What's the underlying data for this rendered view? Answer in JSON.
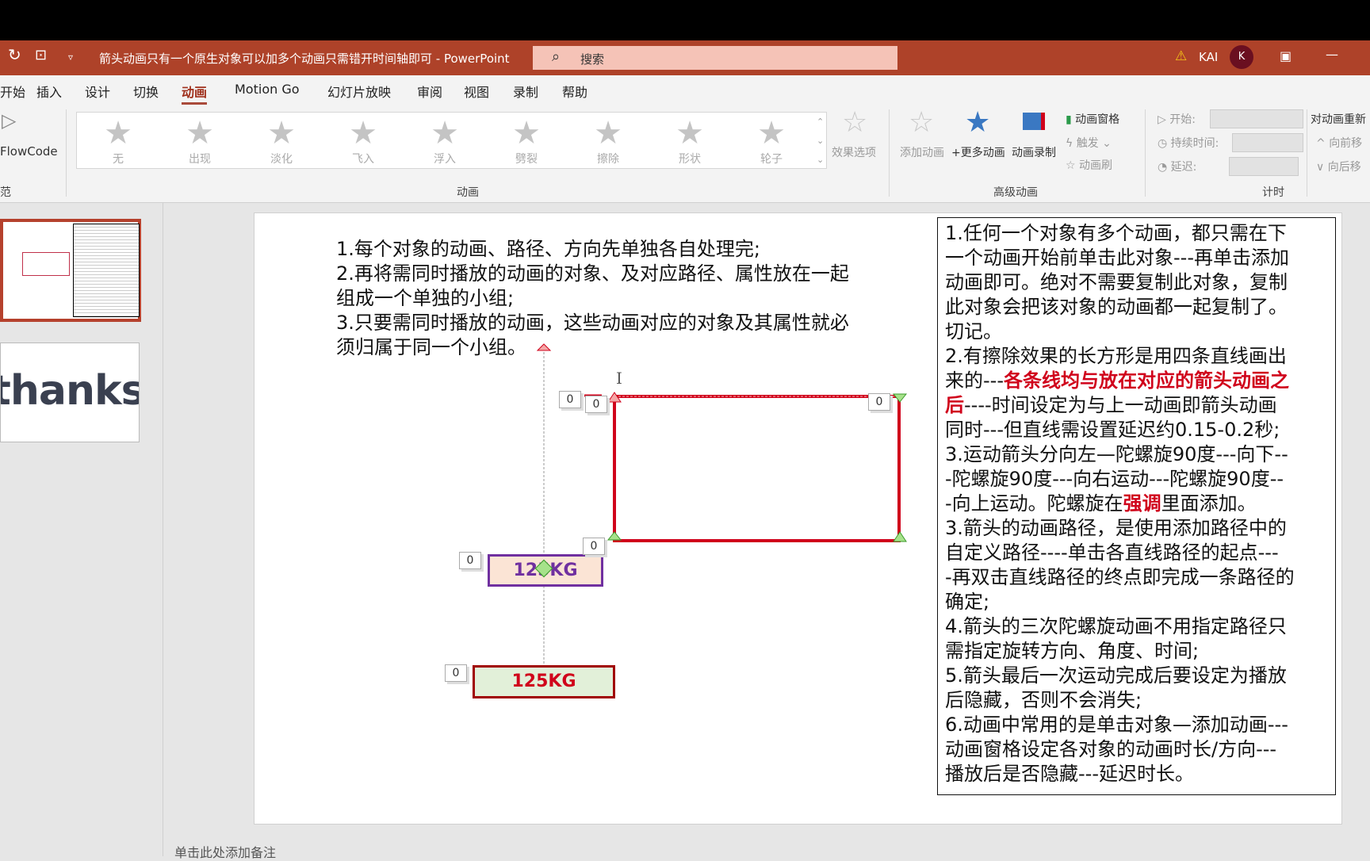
{
  "titlebar": {
    "title": "箭头动画只有一个原生对象可以加多个动画只需错开时间轴即可  -  PowerPoint",
    "search_placeholder": "搜索",
    "user": "KAI",
    "avatar_initial": "K",
    "accent": "#ae4229"
  },
  "tabs": [
    {
      "label": "开始"
    },
    {
      "label": "插入"
    },
    {
      "label": "设计"
    },
    {
      "label": "切换"
    },
    {
      "label": "动画",
      "active": true
    },
    {
      "label": "Motion Go"
    },
    {
      "label": "幻灯片放映"
    },
    {
      "label": "审阅"
    },
    {
      "label": "视图"
    },
    {
      "label": "录制"
    },
    {
      "label": "帮助"
    }
  ],
  "ribbon": {
    "flowcode": "FlowCode",
    "left_group_label": "范",
    "gallery": [
      "无",
      "出现",
      "淡化",
      "飞入",
      "浮入",
      "劈裂",
      "擦除",
      "形状",
      "轮子"
    ],
    "effect_options": "效果选项",
    "animation_group": "动画",
    "add_animation": "添加动画",
    "more_animation": "+更多动画",
    "record_animation": "动画录制",
    "animation_pane": "动画窗格",
    "trigger": "触发",
    "painter": "动画刷",
    "advanced_group": "高级动画",
    "start": "开始:",
    "duration": "持续时间:",
    "delay": "延迟:",
    "timing_group": "计时",
    "reorder": "对动画重新",
    "move_earlier": "向前移",
    "move_later": "向后移"
  },
  "slide": {
    "left_lines": [
      "1.每个对象的动画、路径、方向先单独各自处理完;",
      "2.再将需同时播放的动画的对象、及对应路径、属性放在一起",
      "组成一个单独的小组;",
      "3.只要需同时播放的动画，这些动画对应的对象及其属性就必",
      "须归属于同一个小组。"
    ],
    "right_lines": [
      [
        {
          "t": "1.任何一个对象有多个动画，都只需在下"
        }
      ],
      [
        {
          "t": "一个动画开始前单击此对象---再单击添加"
        }
      ],
      [
        {
          "t": "动画即可。绝对不需要复制此对象，复制"
        }
      ],
      [
        {
          "t": "此对象会把该对象的动画都一起复制了。"
        }
      ],
      [
        {
          "t": "切记。"
        }
      ],
      [
        {
          "t": "2.有擦除效果的长方形是用四条直线画出"
        }
      ],
      [
        {
          "t": "来的---"
        },
        {
          "t": "各条线均与放在对应的箭头动画之",
          "red": true
        }
      ],
      [
        {
          "t": "后",
          "red": true
        },
        {
          "t": "----时间设定为与上一动画即箭头动画"
        }
      ],
      [
        {
          "t": "同时---但直线需设置延迟约0.15-0.2秒;"
        }
      ],
      [
        {
          "t": "3.运动箭头分向左—陀螺旋90度---向下--"
        }
      ],
      [
        {
          "t": "-陀螺旋90度---向右运动---陀螺旋90度--"
        }
      ],
      [
        {
          "t": "-向上运动。陀螺旋在"
        },
        {
          "t": "强调",
          "red": true
        },
        {
          "t": "里面添加。"
        }
      ],
      [
        {
          "t": "3.箭头的动画路径，是使用添加路径中的"
        }
      ],
      [
        {
          "t": "自定义路径----单击各直线路径的起点---"
        }
      ],
      [
        {
          "t": "-再双击直线路径的终点即完成一条路径的"
        }
      ],
      [
        {
          "t": "确定;"
        }
      ],
      [
        {
          "t": "4.箭头的三次陀螺旋动画不用指定路径只"
        }
      ],
      [
        {
          "t": "需指定旋转方向、角度、时间;"
        }
      ],
      [
        {
          "t": "5.箭头最后一次运动完成后要设定为播放"
        }
      ],
      [
        {
          "t": "后隐藏，否则不会消失;"
        }
      ],
      [
        {
          "t": "6.动画中常用的是单击对象—添加动画---"
        }
      ],
      [
        {
          "t": "动画窗格设定各对象的动画时长/方向---"
        }
      ],
      [
        {
          "t": "播放后是否隐藏---延迟时长。"
        }
      ]
    ],
    "box_purple": "125KG",
    "box_green": "125KG",
    "tag": "0"
  },
  "thumbs": {
    "thanks": "thanks"
  },
  "notes": "单击此处添加备注"
}
